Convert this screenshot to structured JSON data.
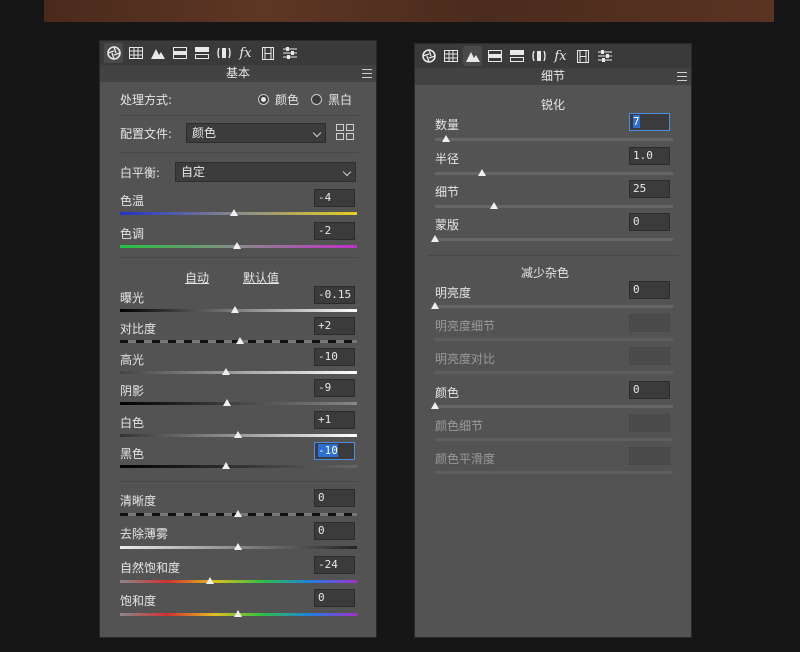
{
  "left": {
    "tabs": [
      "basic-tab",
      "tone-curve-tab",
      "detail-tab",
      "hsl-tab",
      "split-toning-tab",
      "lens-tab",
      "fx",
      "calibration-tab",
      "presets-tab"
    ],
    "fx_label": "fx",
    "title": "基本",
    "treatment_label": "处理方式:",
    "treatment_color": "颜色",
    "treatment_bw": "黑白",
    "profile_label": "配置文件:",
    "profile_value": "颜色",
    "wb_label": "白平衡:",
    "wb_value": "自定",
    "temp_label": "色温",
    "temp_value": "-4",
    "tint_label": "色调",
    "tint_value": "-2",
    "auto_label": "自动",
    "default_label": "默认值",
    "exposure_label": "曝光",
    "exposure_value": "-0.15",
    "contrast_label": "对比度",
    "contrast_value": "+2",
    "highlights_label": "高光",
    "highlights_value": "-10",
    "shadows_label": "阴影",
    "shadows_value": "-9",
    "whites_label": "白色",
    "whites_value": "+1",
    "blacks_label": "黑色",
    "blacks_value": "-10",
    "clarity_label": "清晰度",
    "clarity_value": "0",
    "dehaze_label": "去除薄雾",
    "dehaze_value": "0",
    "vibrance_label": "自然饱和度",
    "vibrance_value": "-24",
    "saturation_label": "饱和度",
    "saturation_value": "0"
  },
  "right": {
    "fx_label": "fx",
    "title": "细节",
    "sharpen_header": "锐化",
    "amount_label": "数量",
    "amount_value": "7",
    "radius_label": "半径",
    "radius_value": "1.0",
    "detail_label": "细节",
    "detail_value": "25",
    "masking_label": "蒙版",
    "masking_value": "0",
    "nr_header": "减少杂色",
    "luminance_label": "明亮度",
    "luminance_value": "0",
    "lum_detail_label": "明亮度细节",
    "lum_contrast_label": "明亮度对比",
    "color_label": "颜色",
    "color_value": "0",
    "color_detail_label": "颜色细节",
    "color_smooth_label": "颜色平滑度"
  },
  "colors": {
    "selection": "#2b6fd6",
    "panel": "#535353",
    "background": "#161616"
  }
}
